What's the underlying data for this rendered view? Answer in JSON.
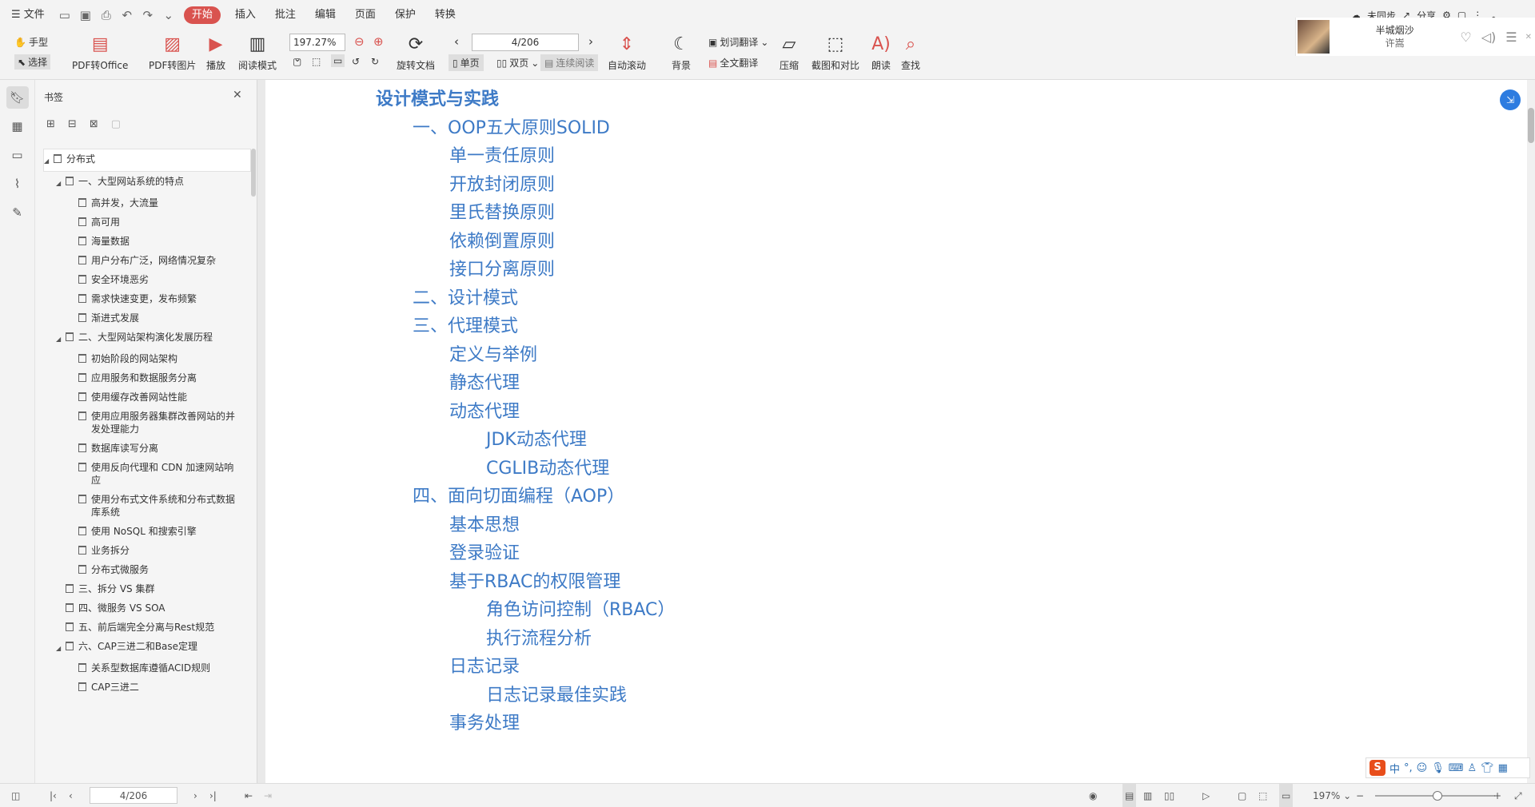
{
  "menu": {
    "file": "文件",
    "start": "开始",
    "insert": "插入",
    "annotate": "批注",
    "edit": "编辑",
    "page": "页面",
    "protect": "保护",
    "convert": "转换"
  },
  "topright": {
    "sync": "未同步",
    "share": "分享"
  },
  "ribbon": {
    "hand": "手型",
    "select": "选择",
    "pdf_office": "PDF转Office",
    "pdf_image": "PDF转图片",
    "play": "播放",
    "read_mode": "阅读模式",
    "zoom": "197.27%",
    "rotate": "旋转文档",
    "page_input": "4/206",
    "single": "单页",
    "double": "双页",
    "continuous": "连续阅读",
    "autoscroll": "自动滚动",
    "background": "背景",
    "word_translate": "划词翻译",
    "full_translate": "全文翻译",
    "compress": "压缩",
    "screenshot_compare": "截图和对比",
    "read_aloud": "朗读",
    "find": "查找"
  },
  "music": {
    "title": "半城烟沙",
    "artist": "许嵩"
  },
  "bookmark": {
    "title": "书签",
    "items": [
      {
        "label": "分布式",
        "level": 0,
        "tri": "◢"
      },
      {
        "label": "一、大型网站系统的特点",
        "level": 1,
        "tri": "◢"
      },
      {
        "label": "高并发，大流量",
        "level": 2,
        "tri": ""
      },
      {
        "label": "高可用",
        "level": 2,
        "tri": ""
      },
      {
        "label": "海量数据",
        "level": 2,
        "tri": ""
      },
      {
        "label": "用户分布广泛，网络情况复杂",
        "level": 2,
        "tri": ""
      },
      {
        "label": "安全环境恶劣",
        "level": 2,
        "tri": ""
      },
      {
        "label": "需求快速变更，发布频繁",
        "level": 2,
        "tri": ""
      },
      {
        "label": "渐进式发展",
        "level": 2,
        "tri": ""
      },
      {
        "label": "二、大型网站架构演化发展历程",
        "level": 1,
        "tri": "◢"
      },
      {
        "label": "初始阶段的网站架构",
        "level": 2,
        "tri": ""
      },
      {
        "label": "应用服务和数据服务分离",
        "level": 2,
        "tri": ""
      },
      {
        "label": "使用缓存改善网站性能",
        "level": 2,
        "tri": ""
      },
      {
        "label": "使用应用服务器集群改善网站的并发处理能力",
        "level": 2,
        "tri": ""
      },
      {
        "label": "数据库读写分离",
        "level": 2,
        "tri": ""
      },
      {
        "label": "使用反向代理和 CDN 加速网站响应",
        "level": 2,
        "tri": ""
      },
      {
        "label": "使用分布式文件系统和分布式数据库系统",
        "level": 2,
        "tri": ""
      },
      {
        "label": "使用 NoSQL 和搜索引擎",
        "level": 2,
        "tri": ""
      },
      {
        "label": "业务拆分",
        "level": 2,
        "tri": ""
      },
      {
        "label": "分布式微服务",
        "level": 2,
        "tri": ""
      },
      {
        "label": "三、拆分 VS 集群",
        "level": 1,
        "tri": ""
      },
      {
        "label": "四、微服务 VS SOA",
        "level": 1,
        "tri": ""
      },
      {
        "label": "五、前后端完全分离与Rest规范",
        "level": 1,
        "tri": ""
      },
      {
        "label": "六、CAP三进二和Base定理",
        "level": 1,
        "tri": "◢"
      },
      {
        "label": "关系型数据库遵循ACID规则",
        "level": 2,
        "tri": ""
      },
      {
        "label": "CAP三进二",
        "level": 2,
        "tri": ""
      }
    ]
  },
  "content": {
    "items": [
      {
        "text": "设计模式与实践",
        "level": 0
      },
      {
        "text": "一、OOP五大原则SOLID",
        "level": 1
      },
      {
        "text": "单一责任原则",
        "level": 2
      },
      {
        "text": "开放封闭原则",
        "level": 2
      },
      {
        "text": "里氏替换原则",
        "level": 2
      },
      {
        "text": "依赖倒置原则",
        "level": 2
      },
      {
        "text": "接口分离原则",
        "level": 2
      },
      {
        "text": "二、设计模式",
        "level": 1
      },
      {
        "text": "三、代理模式",
        "level": 1
      },
      {
        "text": "定义与举例",
        "level": 2
      },
      {
        "text": "静态代理",
        "level": 2
      },
      {
        "text": "动态代理",
        "level": 2
      },
      {
        "text": "JDK动态代理",
        "level": 3
      },
      {
        "text": "CGLIB动态代理",
        "level": 3
      },
      {
        "text": "四、面向切面编程（AOP）",
        "level": 1
      },
      {
        "text": "基本思想",
        "level": 2
      },
      {
        "text": "登录验证",
        "level": 2
      },
      {
        "text": "基于RBAC的权限管理",
        "level": 2
      },
      {
        "text": "角色访问控制（RBAC）",
        "level": 3
      },
      {
        "text": "执行流程分析",
        "level": 3
      },
      {
        "text": "日志记录",
        "level": 2
      },
      {
        "text": "日志记录最佳实践",
        "level": 3
      },
      {
        "text": "事务处理",
        "level": 2
      }
    ]
  },
  "ime": {
    "lang": "中",
    "punct": "°,"
  },
  "status": {
    "page_input": "4/206",
    "zoom": "197%"
  },
  "colors": {
    "accent": "#d9534f",
    "link": "#3d7ac6"
  }
}
